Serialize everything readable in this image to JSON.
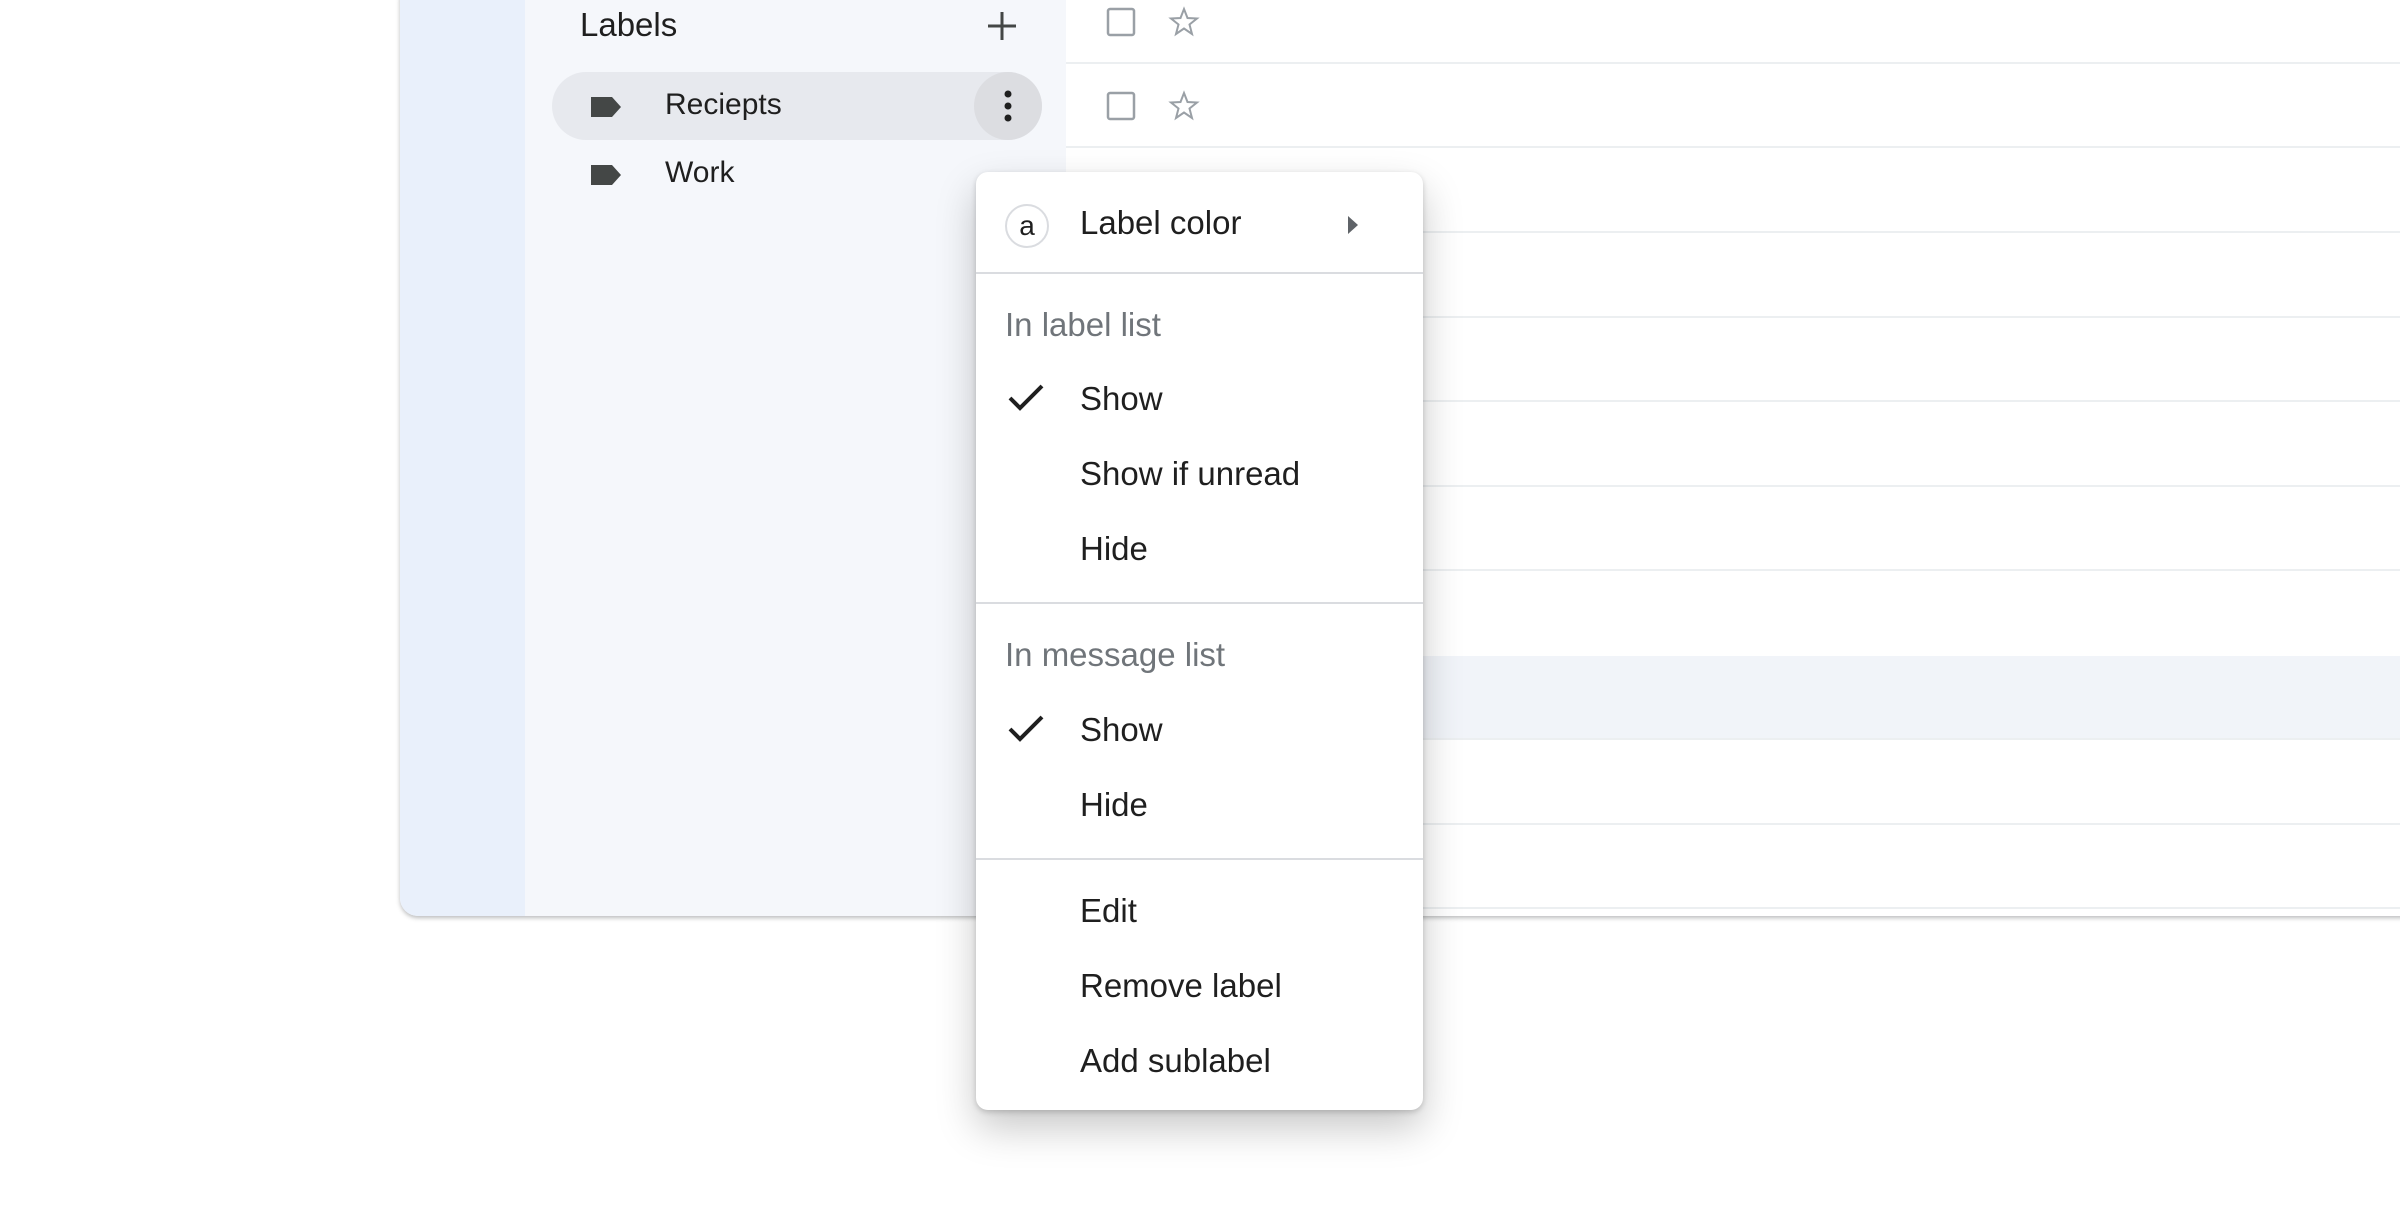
{
  "sidebar": {
    "title": "Labels",
    "add_icon": "plus-icon",
    "items": [
      {
        "label": "Reciepts",
        "icon": "label-tag-icon",
        "active": true
      },
      {
        "label": "Work",
        "icon": "label-tag-icon",
        "active": false
      }
    ],
    "more_icon": "more-vert-icon"
  },
  "message_rows": {
    "checkbox_icon": "checkbox-icon",
    "star_icon": "star-icon"
  },
  "context_menu": {
    "label_color": {
      "label": "Label color",
      "swatch_text": "a"
    },
    "label_list_section": {
      "title": "In label list",
      "options": [
        {
          "label": "Show",
          "checked": true
        },
        {
          "label": "Show if unread",
          "checked": false
        },
        {
          "label": "Hide",
          "checked": false
        }
      ]
    },
    "message_list_section": {
      "title": "In message list",
      "options": [
        {
          "label": "Show",
          "checked": true
        },
        {
          "label": "Hide",
          "checked": false
        }
      ]
    },
    "actions": [
      {
        "label": "Edit"
      },
      {
        "label": "Remove label"
      },
      {
        "label": "Add sublabel"
      }
    ]
  }
}
